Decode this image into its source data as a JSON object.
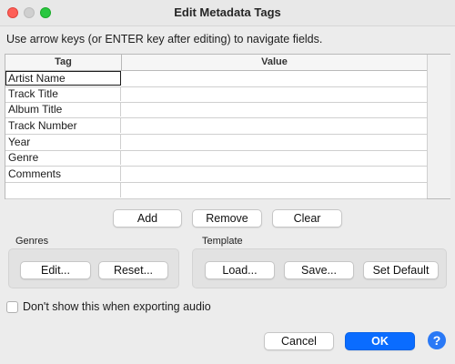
{
  "window": {
    "title": "Edit Metadata Tags"
  },
  "hint": "Use arrow keys (or ENTER key after editing) to navigate fields.",
  "table": {
    "columns": [
      "Tag",
      "Value"
    ],
    "rows": [
      {
        "tag": "Artist Name",
        "value": ""
      },
      {
        "tag": "Track Title",
        "value": ""
      },
      {
        "tag": "Album Title",
        "value": ""
      },
      {
        "tag": "Track Number",
        "value": ""
      },
      {
        "tag": "Year",
        "value": ""
      },
      {
        "tag": "Genre",
        "value": ""
      },
      {
        "tag": "Comments",
        "value": ""
      },
      {
        "tag": "",
        "value": ""
      }
    ]
  },
  "row_buttons": {
    "add": "Add",
    "remove": "Remove",
    "clear": "Clear"
  },
  "genres": {
    "label": "Genres",
    "edit": "Edit...",
    "reset": "Reset..."
  },
  "template": {
    "label": "Template",
    "load": "Load...",
    "save": "Save...",
    "set_default": "Set Default"
  },
  "export_option": {
    "label": "Don't show this when exporting audio",
    "checked": false
  },
  "footer": {
    "cancel": "Cancel",
    "ok": "OK",
    "help": "?"
  }
}
